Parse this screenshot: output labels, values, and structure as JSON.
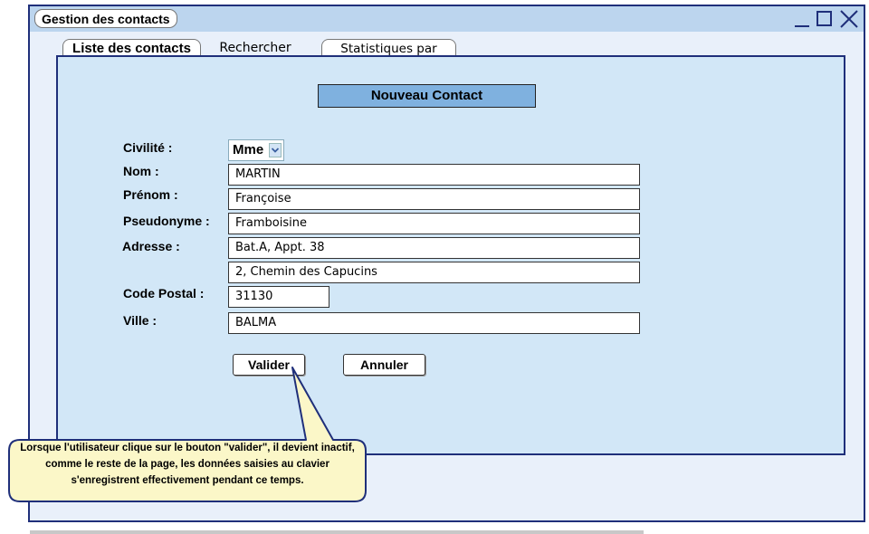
{
  "window": {
    "title": "Gestion des contacts"
  },
  "tabs": [
    {
      "label": "Liste des contacts",
      "active": true
    },
    {
      "label": "Rechercher",
      "active": false
    },
    {
      "label": "Statistiques par civité",
      "active": false
    }
  ],
  "form": {
    "heading": "Nouveau Contact",
    "civilite": {
      "label": "Civilité :",
      "value": "Mme"
    },
    "nom": {
      "label": "Nom :",
      "value": "MARTIN"
    },
    "prenom": {
      "label": "Prénom :",
      "value": "Françoise"
    },
    "pseudonyme": {
      "label": "Pseudonyme :",
      "value": "Framboisine"
    },
    "adresse": {
      "label": "Adresse :",
      "line1": "Bat.A, Appt. 38",
      "line2": "2, Chemin des Capucins"
    },
    "code_postal": {
      "label": "Code Postal :",
      "value": "31130"
    },
    "ville": {
      "label": "Ville :",
      "value": "BALMA"
    },
    "buttons": {
      "validate": "Valider",
      "cancel": "Annuler"
    }
  },
  "callout": {
    "text": "Lorsque l'utilisateur clique sur le bouton \"valider\", il devient inactif, comme le reste de la page, les données saisies au clavier s'enregistrent effectivement pendant ce temps."
  },
  "icons": {
    "minimize": "minimize-icon",
    "maximize": "maximize-icon",
    "close": "close-icon",
    "dropdown": "chevron-down-icon"
  },
  "colors": {
    "window_border": "#1f2f7a",
    "titlebar": "#bcd5ee",
    "panel": "#d2e7f7",
    "heading": "#7fb1df",
    "callout": "#fbf7c8"
  }
}
